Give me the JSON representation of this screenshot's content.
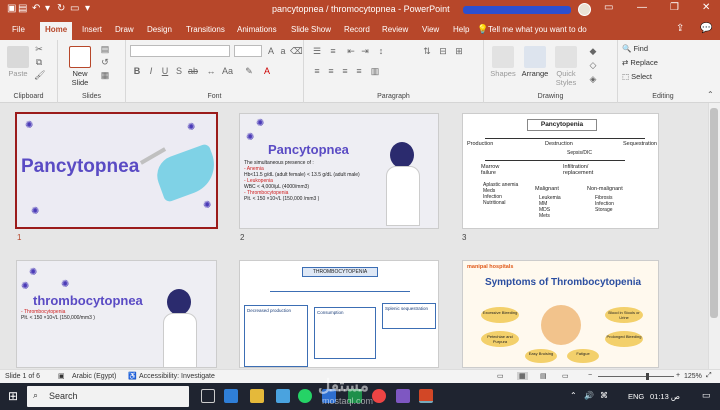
{
  "window": {
    "title": "pancytopnea / thromocytopnea  -  PowerPoint"
  },
  "tabs": [
    "File",
    "Home",
    "Insert",
    "Draw",
    "Design",
    "Transitions",
    "Animations",
    "Slide Show",
    "Record",
    "Review",
    "View",
    "Help"
  ],
  "tellme": "Tell me what you want to do",
  "ribbon": {
    "clipboard": {
      "paste": "Paste",
      "label": "Clipboard"
    },
    "slides": {
      "new_slide": "New Slide",
      "label": "Slides"
    },
    "font": {
      "label": "Font"
    },
    "paragraph": {
      "label": "Paragraph"
    },
    "drawing": {
      "shapes": "Shapes",
      "arrange": "Arrange",
      "quick_styles": "Quick Styles",
      "label": "Drawing"
    },
    "editing": {
      "find": "Find",
      "replace": "Replace",
      "select": "Select",
      "label": "Editing"
    }
  },
  "slides": [
    {
      "num": "1",
      "title": "Pancytopnea"
    },
    {
      "num": "2",
      "title": "Pancytopnea",
      "lines": [
        "The simultaneous presence of :",
        "-  Anemia",
        "Hb<11.5 g/dL (adult female) < 13.5 g/dL (adult male)",
        "-  Leukopenia",
        "WBC < 4,000/μL (4000/mm3)",
        "-  Thrombocytopenia",
        "Plt. < 150 ×10⁹/L (150,000 /mm3 )"
      ]
    },
    {
      "num": "3",
      "title": "Pancytopenia",
      "production": "Production",
      "destruction": "Destruction",
      "sequestration": "Sequestration",
      "sepsis": "Sepsis/DIC",
      "marrow": "Marrow failure",
      "infiltration": "Infiltration/ replacement",
      "left_list": [
        "Aplastic anemia",
        "Meds",
        "Infection",
        "Nutritional"
      ],
      "malignant": "Malignant",
      "non_malignant": "Non-malignant",
      "mal_list": [
        "Leukemia",
        "MM",
        "MDS",
        "Mets"
      ],
      "non_list": [
        "Fibrosis",
        "Infection",
        "Storage"
      ]
    },
    {
      "num": "",
      "title": "thrombocytopnea",
      "lines": [
        "-  Thrombocytopenia",
        "Plt. < 150 ×10⁹/L (150,000/mm3 )"
      ]
    },
    {
      "num": "",
      "header": "THROMBOCYTOPENIA",
      "box1": "Decreased production",
      "box2": "Consumption",
      "box3": "Splenic sequestration"
    },
    {
      "num": "",
      "brand": "manipal hospitals",
      "title": "Symptoms of Thrombocytopenia",
      "bubbles": [
        "Excessive Bleeding",
        "Blood in Stools or Urine",
        "Petechiae and Purpura",
        "Prolonged Bleeding",
        "Easy Bruising",
        "Fatigue"
      ]
    }
  ],
  "status": {
    "slide": "Slide 1 of 6",
    "language": "Arabic (Egypt)",
    "accessibility": "Accessibility: Investigate",
    "zoom": "125%"
  },
  "taskbar": {
    "search": "Search",
    "lang": "ENG",
    "time": "01:13 ص",
    "watermark": "مستقل",
    "watermark_latin": "mostaql.com"
  }
}
